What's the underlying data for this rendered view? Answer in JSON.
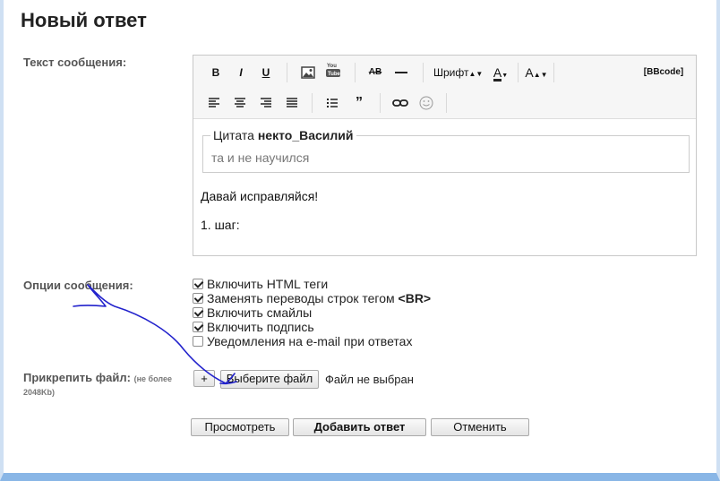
{
  "page": {
    "title": "Новый ответ"
  },
  "labels": {
    "message_text": "Текст сообщения:",
    "message_options": "Опции сообщения:",
    "attach_file": "Прикрепить файл:",
    "attach_note_1": "(не более",
    "attach_note_2": "2048Kb)"
  },
  "toolbar": {
    "bold": "B",
    "italic": "I",
    "underline": "U",
    "font": "Шрифт",
    "font_color": "A",
    "font_size": "A",
    "bbcode": "[BBcode]"
  },
  "editor": {
    "quote_label": "Цитата",
    "quote_author": "некто_Василий",
    "quote_text": "та и не научился",
    "line1": "Давай исправляйся!",
    "line2": "1. шаг:"
  },
  "options": [
    {
      "label": "Включить HTML теги",
      "checked": true
    },
    {
      "label": "Заменять переводы строк тегом",
      "label_bold": "<BR>",
      "checked": true
    },
    {
      "label": "Включить смайлы",
      "checked": true
    },
    {
      "label": "Включить подпись",
      "checked": true
    },
    {
      "label": "Уведомления на e-mail при ответах",
      "checked": false
    }
  ],
  "attach": {
    "plus_label": "+",
    "choose_label": "Выберите файл",
    "status": "Файл не выбран"
  },
  "actions": {
    "preview": "Просмотреть",
    "submit": "Добавить ответ",
    "cancel": "Отменить"
  },
  "colors": {
    "frame_bottom": "#89b6e6",
    "scribble": "#2222cc"
  }
}
